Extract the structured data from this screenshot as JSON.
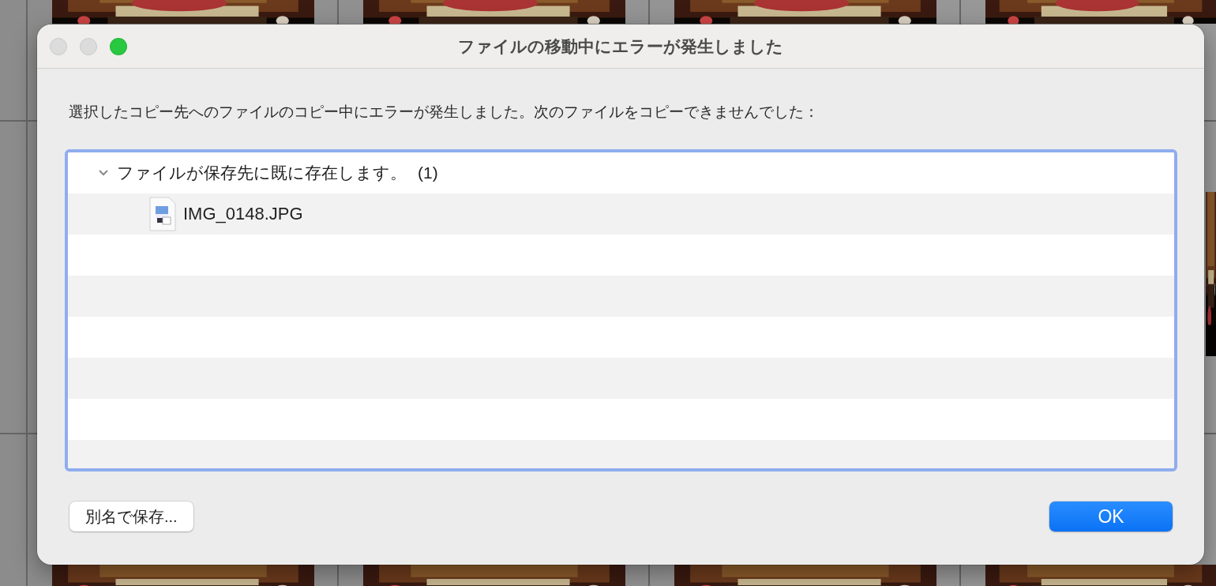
{
  "window": {
    "title": "ファイルの移動中にエラーが発生しました",
    "controls": [
      {
        "kind": "close",
        "enabled": false
      },
      {
        "kind": "minimize",
        "enabled": false
      },
      {
        "kind": "zoom",
        "enabled": true
      }
    ]
  },
  "message": "選択したコピー先へのファイルのコピー中にエラーが発生しました。次のファイルをコピーできませんでした：",
  "list": {
    "groups": [
      {
        "label": "ファイルが保存先に既に存在します。",
        "count": "(1)",
        "expanded": true,
        "children": [
          {
            "name": "IMG_0148.JPG"
          }
        ]
      }
    ]
  },
  "buttons": [
    {
      "label": "別名で保存...",
      "kind": "normal"
    },
    {
      "label": "OK",
      "kind": "default"
    }
  ]
}
